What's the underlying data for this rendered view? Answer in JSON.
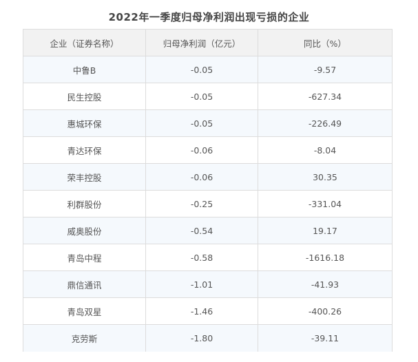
{
  "title": "2022年一季度归母净利润出现亏损的企业",
  "headers": [
    "企业（证券名称）",
    "归母净利润（亿元）",
    "同比（%）"
  ],
  "rows": [
    [
      "中鲁B",
      "-0.05",
      "-9.57"
    ],
    [
      "民生控股",
      "-0.05",
      "-627.34"
    ],
    [
      "惠城环保",
      "-0.05",
      "-226.49"
    ],
    [
      "青达环保",
      "-0.06",
      "-8.04"
    ],
    [
      "荣丰控股",
      "-0.06",
      "30.35"
    ],
    [
      "利群股份",
      "-0.25",
      "-331.04"
    ],
    [
      "威奥股份",
      "-0.54",
      "19.17"
    ],
    [
      "青岛中程",
      "-0.58",
      "-1616.18"
    ],
    [
      "鼎信通讯",
      "-1.01",
      "-41.93"
    ],
    [
      "青岛双星",
      "-1.46",
      "-400.26"
    ],
    [
      "克劳斯",
      "-1.80",
      "-39.11"
    ]
  ],
  "colors": {
    "header_bg": "#f2f2f2",
    "row_alt_bg": "#f5f9fd",
    "border": "#dcdcdc",
    "text": "#555555"
  }
}
